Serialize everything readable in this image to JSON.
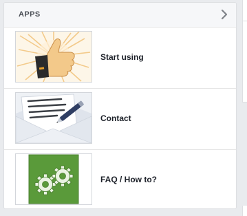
{
  "panel": {
    "title": "APPS",
    "chevron_icon": "chevron-right-icon"
  },
  "apps": [
    {
      "label": "Start using",
      "icon": "thumbs-up-illustration"
    },
    {
      "label": "Contact",
      "icon": "envelope-letter-pen-illustration"
    },
    {
      "label": "FAQ / How to?",
      "icon": "gears-illustration"
    }
  ],
  "colors": {
    "header_bg": "#f6f7f9",
    "border": "#dddfe2",
    "gears_green": "#5a9a3a"
  }
}
